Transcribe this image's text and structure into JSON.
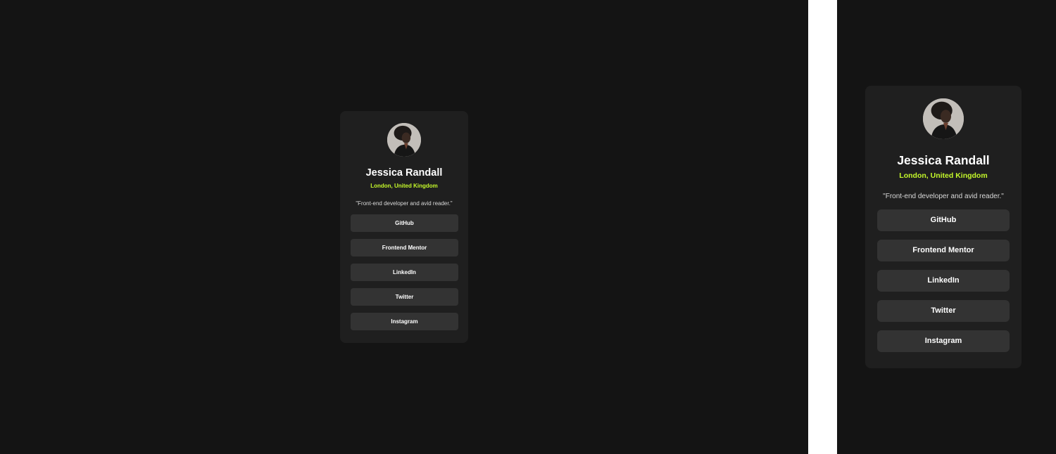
{
  "colors": {
    "page_background": "#141414",
    "card_background": "#1f1f1f",
    "button_background": "#333333",
    "accent_green": "#c4f82a",
    "divider": "#ffffff"
  },
  "profile": {
    "avatar_icon": "profile-photo",
    "name": "Jessica Randall",
    "location": "London, United Kingdom",
    "bio": "\"Front-end developer and avid reader.\"",
    "links": [
      {
        "label": "GitHub"
      },
      {
        "label": "Frontend Mentor"
      },
      {
        "label": "LinkedIn"
      },
      {
        "label": "Twitter"
      },
      {
        "label": "Instagram"
      }
    ]
  }
}
